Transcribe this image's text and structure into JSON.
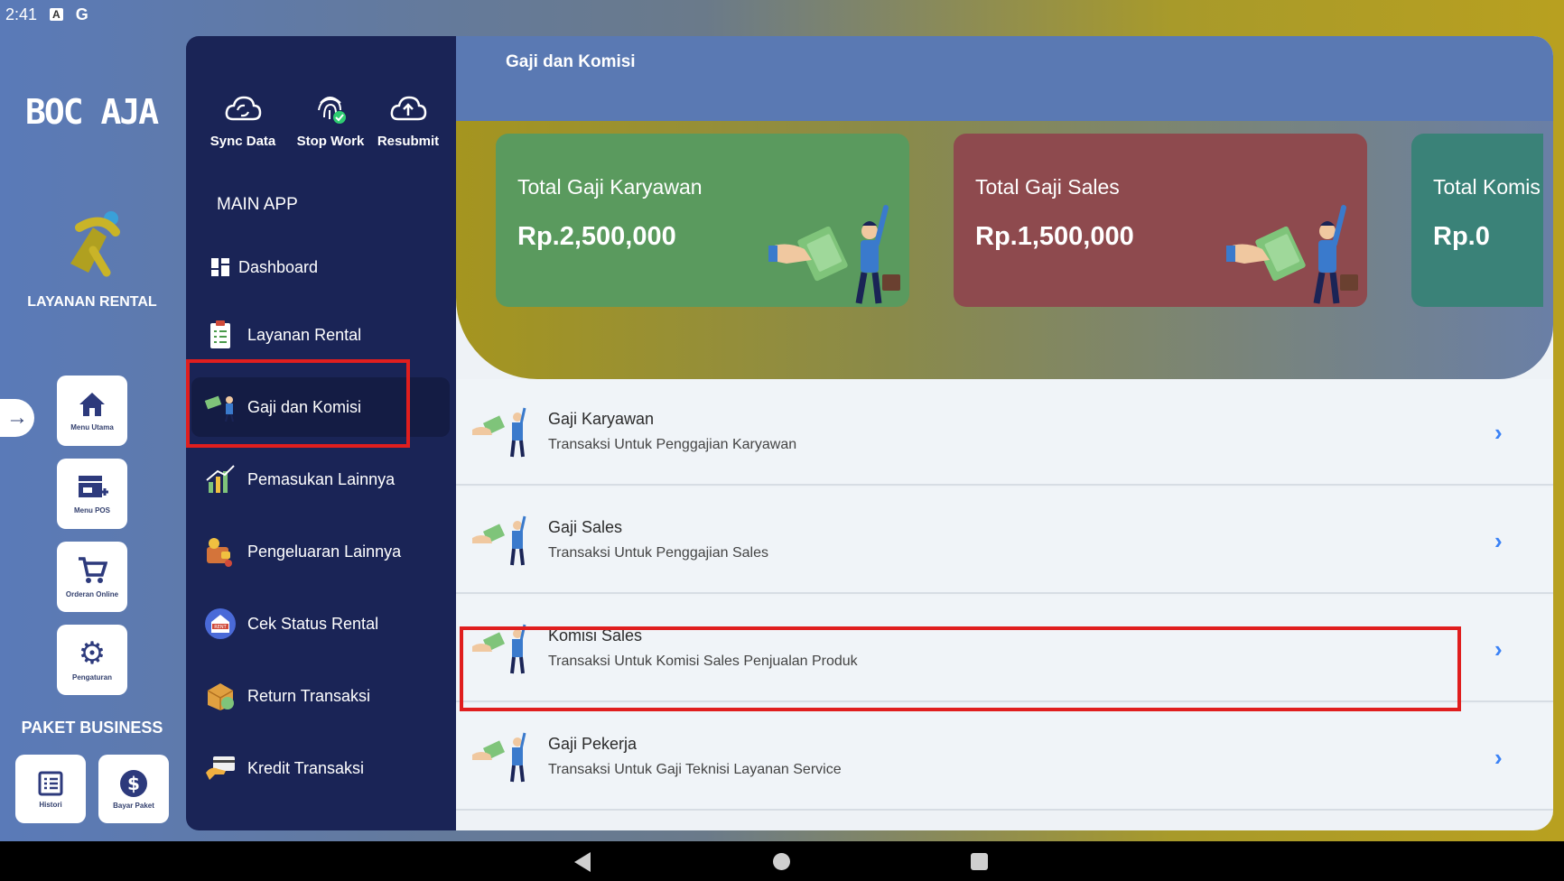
{
  "status_bar": {
    "time": "2:41",
    "icon_a": "A",
    "icon_g": "G"
  },
  "rail": {
    "logo": "BOC AJA",
    "service_label": "LAYANAN RENTAL",
    "buttons": [
      {
        "label": "Menu Utama",
        "icon": "home-icon"
      },
      {
        "label": "Menu POS",
        "icon": "store-icon"
      },
      {
        "label": "Orderan Online",
        "icon": "cart-icon"
      },
      {
        "label": "Pengaturan",
        "icon": "gear-icon"
      }
    ],
    "paket_label": "PAKET BUSINESS",
    "bottom_buttons": [
      {
        "label": "Histori",
        "icon": "list-icon"
      },
      {
        "label": "Bayar Paket",
        "icon": "dollar-icon"
      }
    ]
  },
  "drawer": {
    "quick_actions": [
      {
        "label": "Sync Data",
        "icon": "cloud-sync-icon"
      },
      {
        "label": "Stop Work",
        "icon": "fingerprint-icon"
      },
      {
        "label": "Resubmit",
        "icon": "cloud-upload-icon"
      }
    ],
    "section_title": "MAIN APP",
    "menu": [
      {
        "label": "Dashboard",
        "icon": "dashboard-icon"
      },
      {
        "label": "Layanan Rental",
        "icon": "checklist-icon"
      },
      {
        "label": "Gaji dan Komisi",
        "icon": "money-hand-icon",
        "active": true
      },
      {
        "label": "Pemasukan Lainnya",
        "icon": "income-icon"
      },
      {
        "label": "Pengeluaran Lainnya",
        "icon": "expense-icon"
      },
      {
        "label": "Cek Status Rental",
        "icon": "rent-icon"
      },
      {
        "label": "Return Transaksi",
        "icon": "return-box-icon"
      },
      {
        "label": "Kredit Transaksi",
        "icon": "credit-card-icon"
      }
    ]
  },
  "main": {
    "title": "Gaji dan Komisi",
    "cards": [
      {
        "title": "Total Gaji Karyawan",
        "value": "Rp.2,500,000",
        "color": "#5a9a5e"
      },
      {
        "title": "Total Gaji Sales",
        "value": "Rp.1,500,000",
        "color": "#8e4a4e"
      },
      {
        "title": "Total Komis",
        "value": "Rp.0",
        "color": "#3a8278"
      }
    ],
    "list": [
      {
        "title": "Gaji Karyawan",
        "subtitle": "Transaksi Untuk Penggajian Karyawan"
      },
      {
        "title": "Gaji Sales",
        "subtitle": "Transaksi Untuk Penggajian Sales"
      },
      {
        "title": "Komisi Sales",
        "subtitle": "Transaksi Untuk Komisi Sales Penjualan Produk"
      },
      {
        "title": "Gaji Pekerja",
        "subtitle": "Transaksi Untuk Gaji Teknisi Layanan Service"
      }
    ]
  },
  "colors": {
    "drawer_bg": "#1a2456",
    "header_bg": "#5a79b3",
    "highlight": "#e01e1e",
    "chevron": "#3b82f6"
  }
}
